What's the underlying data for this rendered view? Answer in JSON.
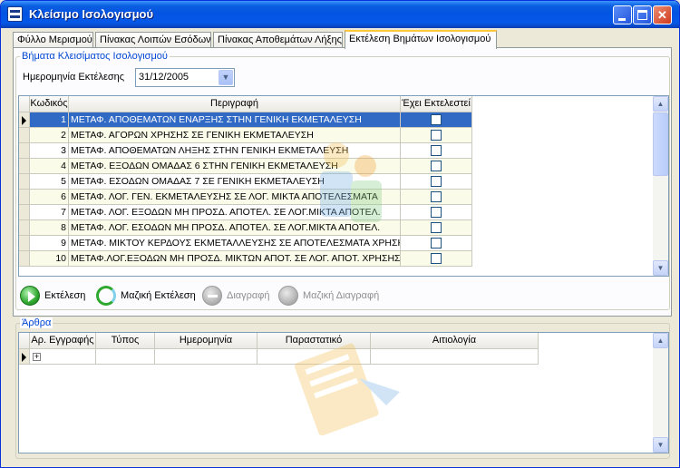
{
  "window": {
    "title": "Κλείσιμο Ισολογισμού"
  },
  "tabs": [
    {
      "label": "Φύλλο Μερισμού"
    },
    {
      "label": "Πίνακας Λοιπών Εσόδων"
    },
    {
      "label": "Πίνακας Αποθεμάτων Λήξης"
    },
    {
      "label": "Εκτέλεση Βημάτων Ισολογισμού"
    }
  ],
  "steps_group": {
    "title": "Βήματα Κλεισίματος Ισολογισμού",
    "date_label": "Ημερομηνία Εκτέλεσης",
    "date_value": "31/12/2005"
  },
  "steps_grid": {
    "columns": {
      "code": "Κωδικός",
      "description": "Περιγραφή",
      "executed": "Έχει Εκτελεστεί"
    },
    "rows": [
      {
        "code": "1",
        "description": "ΜΕΤΑΦ. ΑΠΟΘΕΜΑΤΩΝ ΕΝΑΡΞΗΣ ΣΤΗΝ ΓΕΝΙΚΗ ΕΚΜΕΤΑΛΕΥΣΗ"
      },
      {
        "code": "2",
        "description": "ΜΕΤΑΦ. ΑΓΟΡΩΝ ΧΡΗΣΗΣ ΣΕ ΓΕΝΙΚΗ ΕΚΜΕΤΑΛΕΥΣΗ"
      },
      {
        "code": "3",
        "description": "ΜΕΤΑΦ. ΑΠΟΘΕΜΑΤΩΝ ΛΗΞΗΣ ΣΤΗΝ ΓΕΝΙΚΗ ΕΚΜΕΤΑΛΕΥΣΗ"
      },
      {
        "code": "4",
        "description": "ΜΕΤΑΦ. ΕΞΟΔΩΝ ΟΜΑΔΑΣ 6 ΣΤΗΝ ΓΕΝΙΚΗ ΕΚΜΕΤΑΛΕΥΣΗ"
      },
      {
        "code": "5",
        "description": "ΜΕΤΑΦ. ΕΣΟΔΩΝ ΟΜΑΔΑΣ 7 ΣΕ ΓΕΝΙΚΗ ΕΚΜΕΤΑΛΕΥΣΗ"
      },
      {
        "code": "6",
        "description": "ΜΕΤΑΦ. ΛΟΓ. ΓΕΝ. ΕΚΜΕΤΑΛΕΥΣΗΣ ΣΕ ΛΟΓ. ΜΙΚΤΑ ΑΠΟΤΕΛΕΣΜΑΤΑ"
      },
      {
        "code": "7",
        "description": "ΜΕΤΑΦ. ΛΟΓ. ΕΞΟΔΩΝ ΜΗ ΠΡΟΣΔ. ΑΠΟΤΕΛ. ΣΕ ΛΟΓ.ΜΙΚΤΑ ΑΠΟΤΕΛ."
      },
      {
        "code": "8",
        "description": "ΜΕΤΑΦ. ΛΟΓ. ΕΣΟΔΩΝ ΜΗ ΠΡΟΣΔ. ΑΠΟΤΕΛ. ΣΕ ΛΟΓ.ΜΙΚΤΑ ΑΠΟΤΕΛ."
      },
      {
        "code": "9",
        "description": "ΜΕΤΑΦ. ΜΙΚΤΟΥ ΚΕΡΔΟΥΣ ΕΚΜΕΤΑΛΛΕΥΣΗΣ ΣΕ ΑΠΟΤΕΛΕΣΜΑΤΑ ΧΡΗΣΗΣ"
      },
      {
        "code": "10",
        "description": "ΜΕΤΑΦ.ΛΟΓ.ΕΞΟΔΩΝ ΜΗ ΠΡΟΣΔ. ΜΙΚΤΩΝ ΑΠΟΤ. ΣΕ ΛΟΓ. ΑΠΟΤ. ΧΡΗΣΗΣ"
      }
    ]
  },
  "toolbar": {
    "execute": "Εκτέλεση",
    "bulk_execute": "Μαζική Εκτέλεση",
    "delete": "Διαγραφή",
    "bulk_delete": "Μαζική Διαγραφή"
  },
  "articles_group": {
    "title": "Άρθρα",
    "columns": {
      "entry_no": "Αρ. Εγγραφής",
      "type": "Τύπος",
      "date": "Ημερομηνία",
      "document": "Παραστατικό",
      "justification": "Αιτιολογία"
    },
    "expander": "+"
  },
  "colors": {
    "selection": "#316ac5",
    "group_title": "#0046d5",
    "titlebar": "#0454e2"
  }
}
